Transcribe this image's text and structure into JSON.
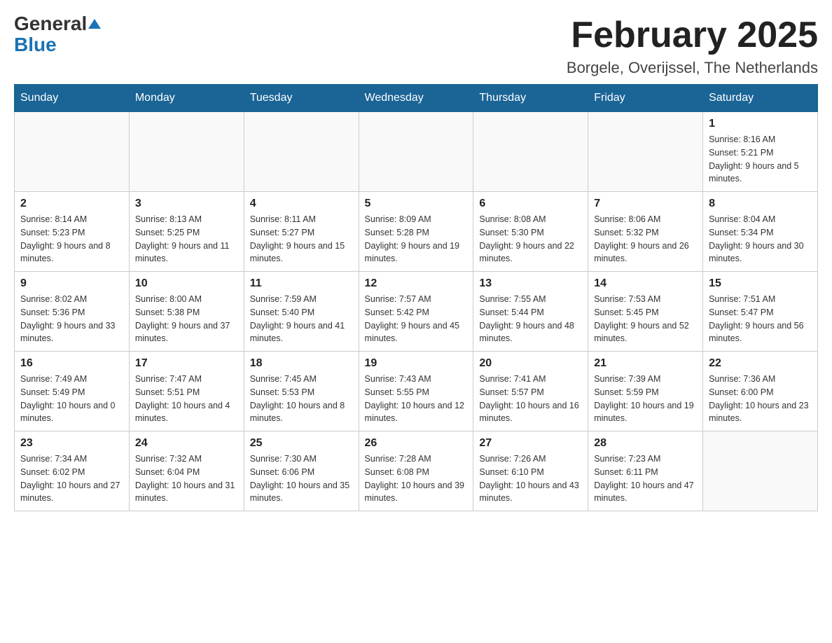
{
  "header": {
    "logo": {
      "general": "General",
      "blue": "Blue",
      "triangle": "▲"
    },
    "title": "February 2025",
    "subtitle": "Borgele, Overijssel, The Netherlands"
  },
  "weekdays": [
    "Sunday",
    "Monday",
    "Tuesday",
    "Wednesday",
    "Thursday",
    "Friday",
    "Saturday"
  ],
  "weeks": [
    [
      {
        "day": "",
        "info": ""
      },
      {
        "day": "",
        "info": ""
      },
      {
        "day": "",
        "info": ""
      },
      {
        "day": "",
        "info": ""
      },
      {
        "day": "",
        "info": ""
      },
      {
        "day": "",
        "info": ""
      },
      {
        "day": "1",
        "info": "Sunrise: 8:16 AM\nSunset: 5:21 PM\nDaylight: 9 hours and 5 minutes."
      }
    ],
    [
      {
        "day": "2",
        "info": "Sunrise: 8:14 AM\nSunset: 5:23 PM\nDaylight: 9 hours and 8 minutes."
      },
      {
        "day": "3",
        "info": "Sunrise: 8:13 AM\nSunset: 5:25 PM\nDaylight: 9 hours and 11 minutes."
      },
      {
        "day": "4",
        "info": "Sunrise: 8:11 AM\nSunset: 5:27 PM\nDaylight: 9 hours and 15 minutes."
      },
      {
        "day": "5",
        "info": "Sunrise: 8:09 AM\nSunset: 5:28 PM\nDaylight: 9 hours and 19 minutes."
      },
      {
        "day": "6",
        "info": "Sunrise: 8:08 AM\nSunset: 5:30 PM\nDaylight: 9 hours and 22 minutes."
      },
      {
        "day": "7",
        "info": "Sunrise: 8:06 AM\nSunset: 5:32 PM\nDaylight: 9 hours and 26 minutes."
      },
      {
        "day": "8",
        "info": "Sunrise: 8:04 AM\nSunset: 5:34 PM\nDaylight: 9 hours and 30 minutes."
      }
    ],
    [
      {
        "day": "9",
        "info": "Sunrise: 8:02 AM\nSunset: 5:36 PM\nDaylight: 9 hours and 33 minutes."
      },
      {
        "day": "10",
        "info": "Sunrise: 8:00 AM\nSunset: 5:38 PM\nDaylight: 9 hours and 37 minutes."
      },
      {
        "day": "11",
        "info": "Sunrise: 7:59 AM\nSunset: 5:40 PM\nDaylight: 9 hours and 41 minutes."
      },
      {
        "day": "12",
        "info": "Sunrise: 7:57 AM\nSunset: 5:42 PM\nDaylight: 9 hours and 45 minutes."
      },
      {
        "day": "13",
        "info": "Sunrise: 7:55 AM\nSunset: 5:44 PM\nDaylight: 9 hours and 48 minutes."
      },
      {
        "day": "14",
        "info": "Sunrise: 7:53 AM\nSunset: 5:45 PM\nDaylight: 9 hours and 52 minutes."
      },
      {
        "day": "15",
        "info": "Sunrise: 7:51 AM\nSunset: 5:47 PM\nDaylight: 9 hours and 56 minutes."
      }
    ],
    [
      {
        "day": "16",
        "info": "Sunrise: 7:49 AM\nSunset: 5:49 PM\nDaylight: 10 hours and 0 minutes."
      },
      {
        "day": "17",
        "info": "Sunrise: 7:47 AM\nSunset: 5:51 PM\nDaylight: 10 hours and 4 minutes."
      },
      {
        "day": "18",
        "info": "Sunrise: 7:45 AM\nSunset: 5:53 PM\nDaylight: 10 hours and 8 minutes."
      },
      {
        "day": "19",
        "info": "Sunrise: 7:43 AM\nSunset: 5:55 PM\nDaylight: 10 hours and 12 minutes."
      },
      {
        "day": "20",
        "info": "Sunrise: 7:41 AM\nSunset: 5:57 PM\nDaylight: 10 hours and 16 minutes."
      },
      {
        "day": "21",
        "info": "Sunrise: 7:39 AM\nSunset: 5:59 PM\nDaylight: 10 hours and 19 minutes."
      },
      {
        "day": "22",
        "info": "Sunrise: 7:36 AM\nSunset: 6:00 PM\nDaylight: 10 hours and 23 minutes."
      }
    ],
    [
      {
        "day": "23",
        "info": "Sunrise: 7:34 AM\nSunset: 6:02 PM\nDaylight: 10 hours and 27 minutes."
      },
      {
        "day": "24",
        "info": "Sunrise: 7:32 AM\nSunset: 6:04 PM\nDaylight: 10 hours and 31 minutes."
      },
      {
        "day": "25",
        "info": "Sunrise: 7:30 AM\nSunset: 6:06 PM\nDaylight: 10 hours and 35 minutes."
      },
      {
        "day": "26",
        "info": "Sunrise: 7:28 AM\nSunset: 6:08 PM\nDaylight: 10 hours and 39 minutes."
      },
      {
        "day": "27",
        "info": "Sunrise: 7:26 AM\nSunset: 6:10 PM\nDaylight: 10 hours and 43 minutes."
      },
      {
        "day": "28",
        "info": "Sunrise: 7:23 AM\nSunset: 6:11 PM\nDaylight: 10 hours and 47 minutes."
      },
      {
        "day": "",
        "info": ""
      }
    ]
  ]
}
